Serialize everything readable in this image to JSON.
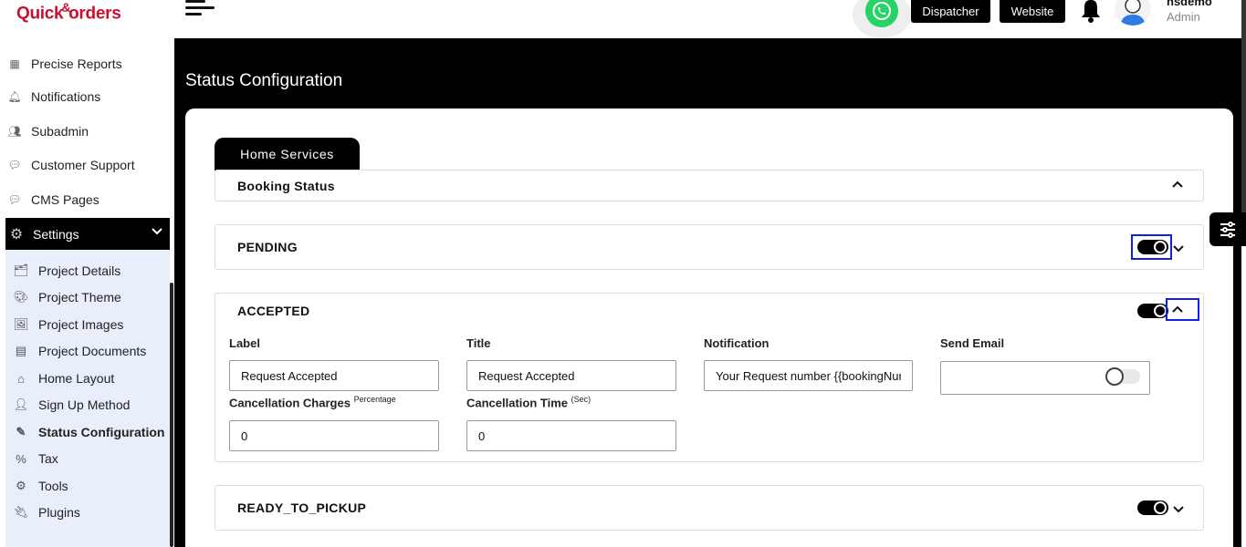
{
  "brand": {
    "logo_part1": "Quick",
    "logo_amp": "&",
    "logo_part2": "orders"
  },
  "sidebar": {
    "items": [
      {
        "label": "Precise Reports"
      },
      {
        "label": "Notifications"
      },
      {
        "label": "Subadmin"
      },
      {
        "label": "Customer Support"
      },
      {
        "label": "CMS Pages"
      }
    ],
    "settings_label": "Settings",
    "sub_items": [
      {
        "label": "Project Details"
      },
      {
        "label": "Project Theme"
      },
      {
        "label": "Project Images"
      },
      {
        "label": "Project Documents"
      },
      {
        "label": "Home Layout"
      },
      {
        "label": "Sign Up Method"
      },
      {
        "label": "Status Configuration"
      },
      {
        "label": "Tax"
      },
      {
        "label": "Tools"
      },
      {
        "label": "Plugins"
      }
    ]
  },
  "topbar": {
    "dispatcher": "Dispatcher",
    "website": "Website",
    "user_name": "hsdemo",
    "user_role": "Admin"
  },
  "page": {
    "title": "Status Configuration",
    "tab": "Home Services",
    "section_title": "Booking Status"
  },
  "statuses": {
    "pending": "PENDING",
    "accepted": "ACCEPTED",
    "ready": "READY_TO_PICKUP"
  },
  "accepted_form": {
    "label_label": "Label",
    "label_value": "Request Accepted",
    "title_label": "Title",
    "title_value": "Request Accepted",
    "notification_label": "Notification",
    "notification_value": "Your Request number {{bookingNur",
    "email_label": "Send Email",
    "cancel_charges_label": "Cancellation Charges",
    "cancel_charges_sup": "Percentage",
    "cancel_charges_value": "0",
    "cancel_time_label": "Cancellation Time",
    "cancel_time_sup": "(Sec)",
    "cancel_time_value": "0"
  },
  "colors": {
    "accent": "#000000",
    "highlight": "#1020e0",
    "sub_panel": "#e9eefb",
    "whatsapp": "#25d366"
  }
}
